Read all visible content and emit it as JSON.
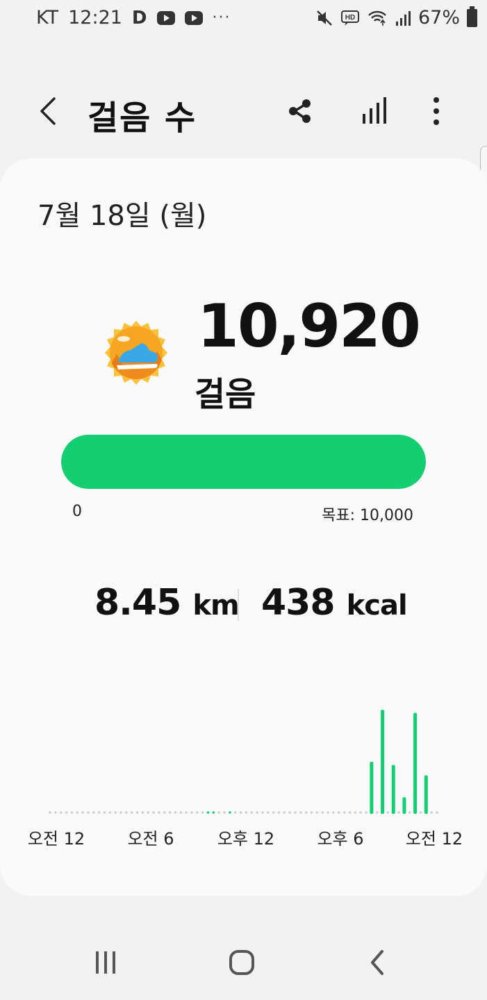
{
  "status_bar": {
    "carrier": "KT",
    "time": "12:21",
    "battery": "67%",
    "overflow": "···",
    "left_icons": [
      "d-app-icon",
      "youtube-icon",
      "youtube-icon"
    ],
    "right_icons": [
      "mute-icon",
      "hd-voice-icon",
      "wifi-icon",
      "signal-icon",
      "battery-icon"
    ]
  },
  "app_bar": {
    "title": "걸음 수",
    "icons": [
      "back-icon",
      "share-icon",
      "stats-icon",
      "more-vert-icon"
    ]
  },
  "summary": {
    "date": "7월 18일 (월)",
    "steps": "10,920",
    "steps_unit": "걸음",
    "progress_fraction": 1.0,
    "progress_min": "0",
    "goal_label": "목표: 10,000",
    "distance_value": "8.45",
    "distance_unit": "km",
    "calories_value": "438",
    "calories_unit": "kcal"
  },
  "colors": {
    "accent": "#14cf72",
    "badge_orange": "#f6a623",
    "badge_gold": "#f9c23c"
  },
  "chart_data": {
    "type": "bar",
    "x_axis_labels": [
      "오전 12",
      "오전 6",
      "오후 12",
      "오후 6",
      "오전 12"
    ],
    "bars": [
      {
        "slot": 59,
        "value": 0.5
      },
      {
        "slot": 61,
        "value": 1.0
      },
      {
        "slot": 63,
        "value": 0.47
      },
      {
        "slot": 65,
        "value": 0.16
      },
      {
        "slot": 67,
        "value": 0.97
      },
      {
        "slot": 69,
        "value": 0.37
      }
    ],
    "active_dots": [
      29,
      30,
      33
    ],
    "total_slots": 72
  },
  "nav_bar": {
    "icons": [
      "recents-icon",
      "home-icon",
      "back-nav-icon"
    ]
  }
}
